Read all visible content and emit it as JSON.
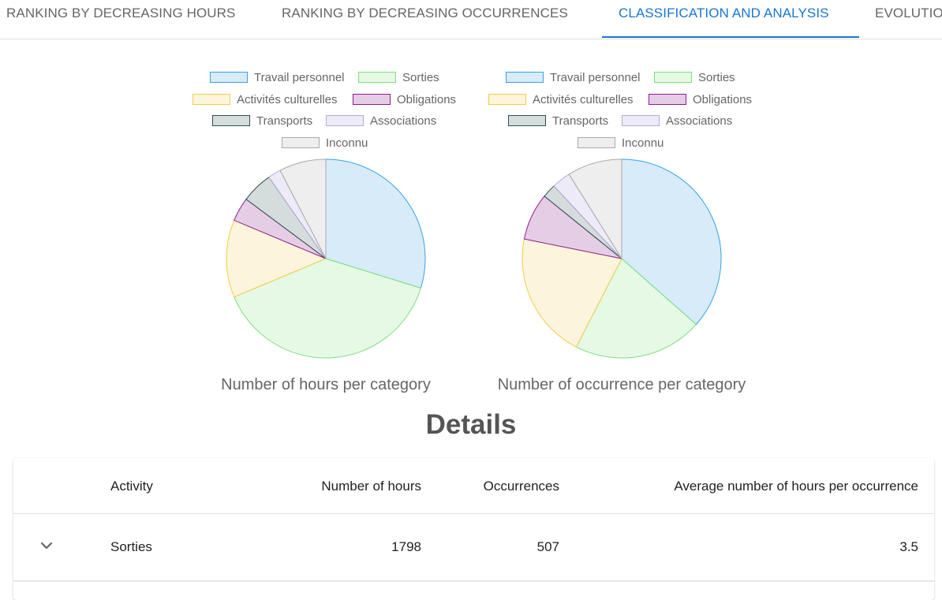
{
  "tabs": [
    {
      "label": "RANKING BY DECREASING HOURS",
      "active": false
    },
    {
      "label": "RANKING BY DECREASING OCCURRENCES",
      "active": false
    },
    {
      "label": "CLASSIFICATION AND ANALYSIS",
      "active": true
    },
    {
      "label": "EVOLUTIO",
      "active": false
    }
  ],
  "legend": [
    {
      "label": "Travail personnel",
      "color": "#36a2eb",
      "fill": "#d7ebf9"
    },
    {
      "label": "Sorties",
      "color": "#7ee07e",
      "fill": "#e5f9e5"
    },
    {
      "label": "Activités culturelles",
      "color": "#f1cd46",
      "fill": "#fdf4dc"
    },
    {
      "label": "Obligations",
      "color": "#8e1b8e",
      "fill": "#e6cde6"
    },
    {
      "label": "Transports",
      "color": "#2f4f4f",
      "fill": "#d5dcdc"
    },
    {
      "label": "Associations",
      "color": "#b6a9dd",
      "fill": "#eeebf8"
    },
    {
      "label": "Inconnu",
      "color": "#aaaaaa",
      "fill": "#eeeeee"
    }
  ],
  "chart_data": [
    {
      "type": "pie",
      "title": "Number of hours per category",
      "categories": [
        "Travail personnel",
        "Sorties",
        "Activités culturelles",
        "Obligations",
        "Transports",
        "Associations",
        "Inconnu"
      ],
      "values": [
        29.8,
        38.9,
        12.6,
        3.9,
        5.1,
        2.1,
        7.6
      ]
    },
    {
      "type": "pie",
      "title": "Number of occurrence per category",
      "categories": [
        "Travail personnel",
        "Sorties",
        "Activités culturelles",
        "Obligations",
        "Transports",
        "Associations",
        "Inconnu"
      ],
      "values": [
        35.8,
        20.6,
        20.2,
        7.5,
        2.2,
        3.0,
        8.7
      ]
    }
  ],
  "details": {
    "title": "Details",
    "headers": {
      "activity": "Activity",
      "hours": "Number of hours",
      "occurrences": "Occurrences",
      "average": "Average number of hours per occurrence"
    },
    "rows": [
      {
        "activity": "Sorties",
        "hours": "1798",
        "occurrences": "507",
        "average": "3.5"
      }
    ]
  }
}
